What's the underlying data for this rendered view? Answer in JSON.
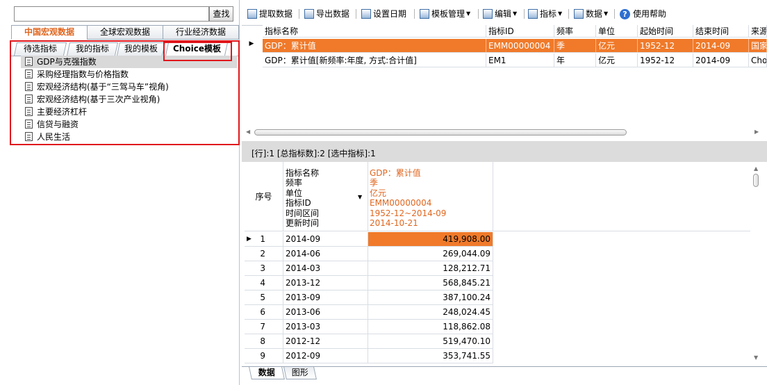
{
  "search": {
    "value": "",
    "button_label": "查找"
  },
  "top_tabs": [
    "中国宏观数据",
    "全球宏观数据",
    "行业经济数据"
  ],
  "sub_tabs": [
    "待选指标",
    "我的指标",
    "我的模板",
    "Choice模板"
  ],
  "tree_items": [
    "GDP与克强指数",
    "采购经理指数与价格指数",
    "宏观经济结构(基于“三驾马车”视角)",
    "宏观经济结构(基于三次产业视角)",
    "主要经济杠杆",
    "信贷与融资",
    "人民生活"
  ],
  "toolbar": {
    "fetch_label": "提取数据",
    "export_label": "导出数据",
    "date_label": "设置日期",
    "template_label": "模板管理",
    "edit_label": "编辑",
    "indicator_label": "指标",
    "data_label": "数据",
    "help_label": "使用帮助"
  },
  "top_grid": {
    "headers": [
      "指标名称",
      "指标ID",
      "频率",
      "单位",
      "起始时间",
      "结束时间",
      "来源"
    ],
    "rows": [
      [
        "GDP：累计值",
        "EMM00000004",
        "季",
        "亿元",
        "1952-12",
        "2014-09",
        "国家统计局"
      ],
      [
        "GDP：累计值[新频率:年度, 方式:合计值]",
        "EM1",
        "年",
        "亿元",
        "1952-12",
        "2014-09",
        "Choice"
      ]
    ]
  },
  "status": {
    "text": "[行]:1  [总指标数]:2  [选中指标]:1"
  },
  "bottom_grid": {
    "seq_header": "序号",
    "label_lines": [
      "指标名称",
      "频率",
      "单位",
      "指标ID",
      "时间区间",
      "更新时间"
    ],
    "value_lines": [
      "GDP：累计值",
      "季",
      "亿元",
      "EMM00000004",
      "1952-12~2014-09",
      "2014-10-21"
    ],
    "rows": [
      {
        "seq": "1",
        "date": "2014-09",
        "value": "419,908.00"
      },
      {
        "seq": "2",
        "date": "2014-06",
        "value": "269,044.09"
      },
      {
        "seq": "3",
        "date": "2014-03",
        "value": "128,212.71"
      },
      {
        "seq": "4",
        "date": "2013-12",
        "value": "568,845.21"
      },
      {
        "seq": "5",
        "date": "2013-09",
        "value": "387,100.24"
      },
      {
        "seq": "6",
        "date": "2013-06",
        "value": "248,024.45"
      },
      {
        "seq": "7",
        "date": "2013-03",
        "value": "118,862.08"
      },
      {
        "seq": "8",
        "date": "2012-12",
        "value": "519,470.10"
      },
      {
        "seq": "9",
        "date": "2012-09",
        "value": "353,741.55"
      }
    ]
  },
  "bottom_tabs": [
    "数据",
    "图形"
  ],
  "colors": {
    "accent": "#f07a2a",
    "highlight_text": "#e0661f",
    "annotation_red": "#e0161c"
  }
}
